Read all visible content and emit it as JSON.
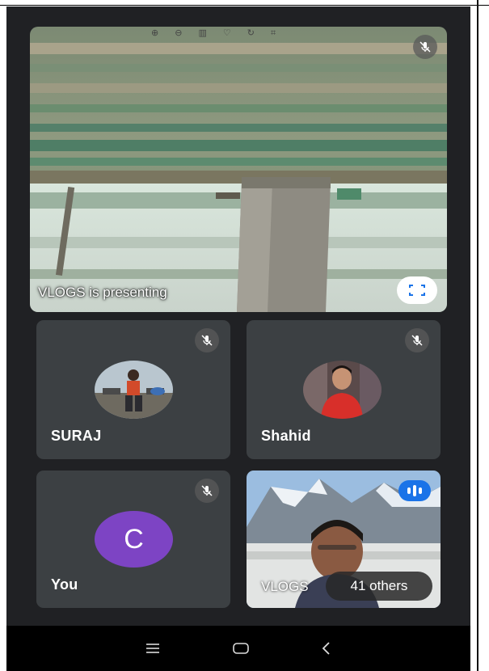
{
  "presentation": {
    "label": "VLOGS is presenting",
    "toolbar_icons": [
      "zoom-in-icon",
      "zoom-out-icon",
      "trash-icon",
      "heart-icon",
      "rotate-icon",
      "crop-icon"
    ]
  },
  "participants": [
    {
      "name": "SURAJ",
      "muted": true
    },
    {
      "name": "Shahid",
      "muted": true
    },
    {
      "name": "You",
      "initial": "C",
      "muted": true,
      "avatar_color": "#7d44c4"
    },
    {
      "name": "VLOGS",
      "speaking": true
    }
  ],
  "others": {
    "label": "41 others"
  },
  "colors": {
    "background": "#202124",
    "tile": "#3c4043",
    "accent": "#1a73e8"
  }
}
